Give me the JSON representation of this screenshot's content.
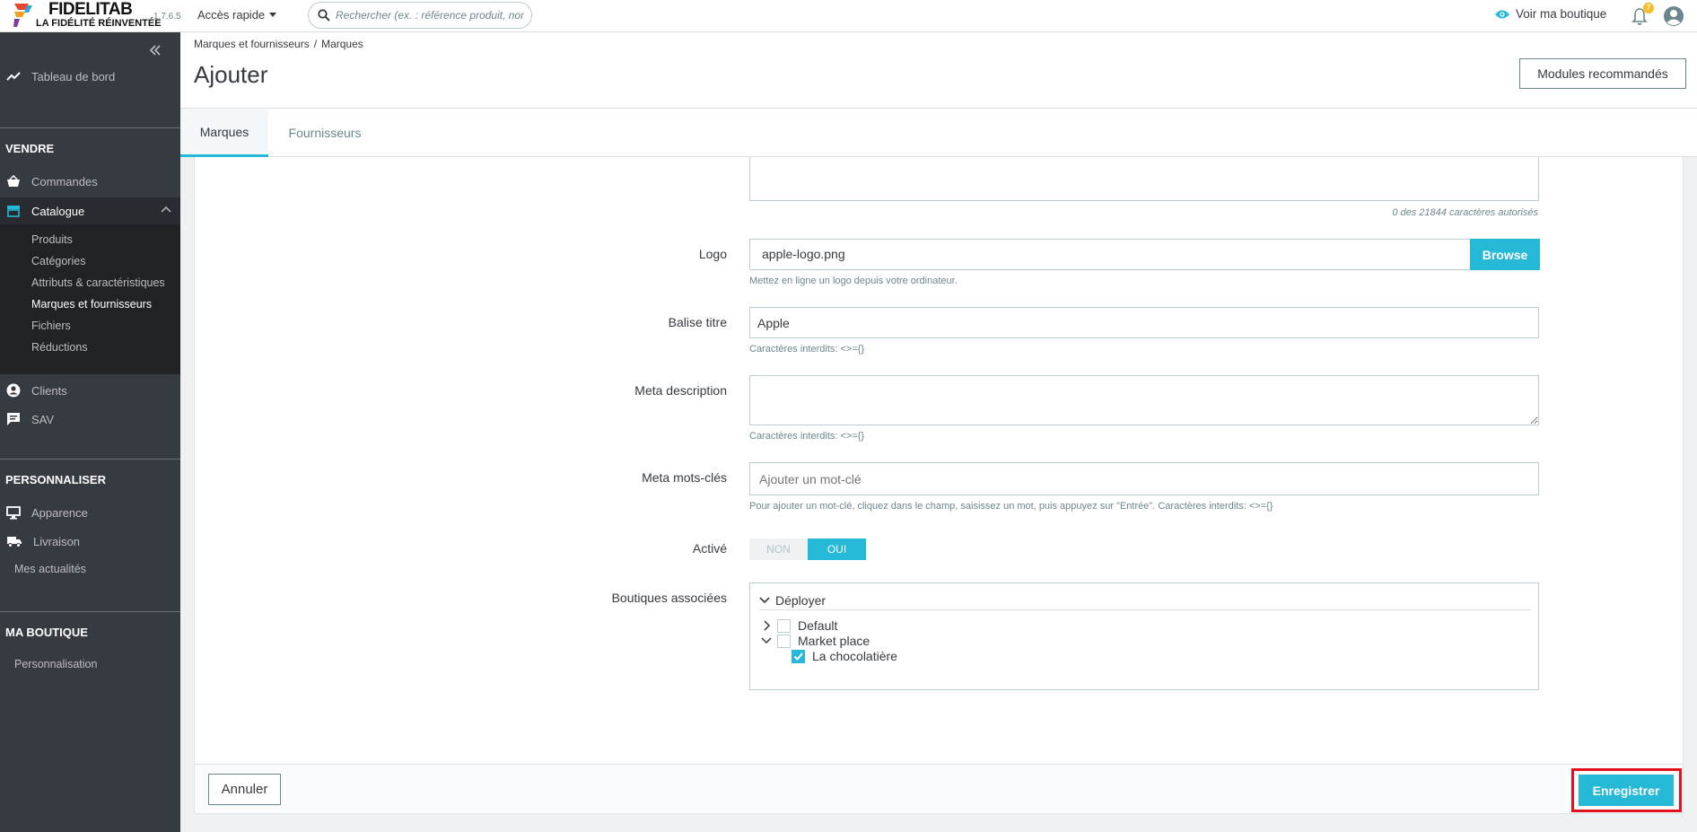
{
  "header": {
    "brand_name": "FIDELITAB",
    "brand_tagline": "LA FIDÉLITÉ RÉINVENTÉE",
    "version": "1.7.6.5",
    "quick_access": "Accès rapide",
    "search_placeholder": "Rechercher (ex. : référence produit, nom",
    "view_shop": "Voir ma boutique",
    "notification_count": "7"
  },
  "sidebar": {
    "dashboard": "Tableau de bord",
    "section_sell": "VENDRE",
    "orders": "Commandes",
    "catalog": "Catalogue",
    "catalog_items": [
      "Produits",
      "Catégories",
      "Attributs & caractéristiques",
      "Marques et fournisseurs",
      "Fichiers",
      "Réductions"
    ],
    "customers": "Clients",
    "support": "SAV",
    "section_customize": "PERSONNALISER",
    "appearance": "Apparence",
    "shipping": "Livraison",
    "news": "Mes actualités",
    "section_shop": "MA BOUTIQUE",
    "personalization": "Personnalisation"
  },
  "page": {
    "breadcrumb": [
      "Marques et fournisseurs",
      "/",
      "Marques"
    ],
    "title": "Ajouter",
    "modules_button": "Modules recommandés",
    "tabs": [
      "Marques",
      "Fournisseurs"
    ]
  },
  "form": {
    "char_counter": "0 des 21844 caractères autorisés",
    "logo_label": "Logo",
    "logo_value": "apple-logo.png",
    "browse": "Browse",
    "logo_help": "Mettez en ligne un logo depuis votre ordinateur.",
    "title_label": "Balise titre",
    "title_value": "Apple",
    "title_help": "Caractères interdits: <>={}",
    "meta_desc_label": "Meta description",
    "meta_desc_value": "",
    "meta_desc_help": "Caractères interdits: <>={}",
    "meta_kw_label": "Meta mots-clés",
    "meta_kw_placeholder": "Ajouter un mot-clé",
    "meta_kw_help": "Pour ajouter un mot-clé, cliquez dans le champ, saisissez un mot, puis appuyez sur \"Entrée\". Caractères interdits: <>={}",
    "active_label": "Activé",
    "active_off": "NON",
    "active_on": "OUI",
    "shops_label": "Boutiques associées",
    "tree_toggle": "Déployer",
    "tree": [
      {
        "label": "Default",
        "checked": false
      },
      {
        "label": "Market place",
        "checked": false
      },
      {
        "label": "La chocolatière",
        "checked": true
      }
    ],
    "cancel": "Annuler",
    "save": "Enregistrer"
  },
  "colors": {
    "accent": "#25b9d7",
    "sidebar": "#363a41",
    "highlight": "#e3111b"
  }
}
